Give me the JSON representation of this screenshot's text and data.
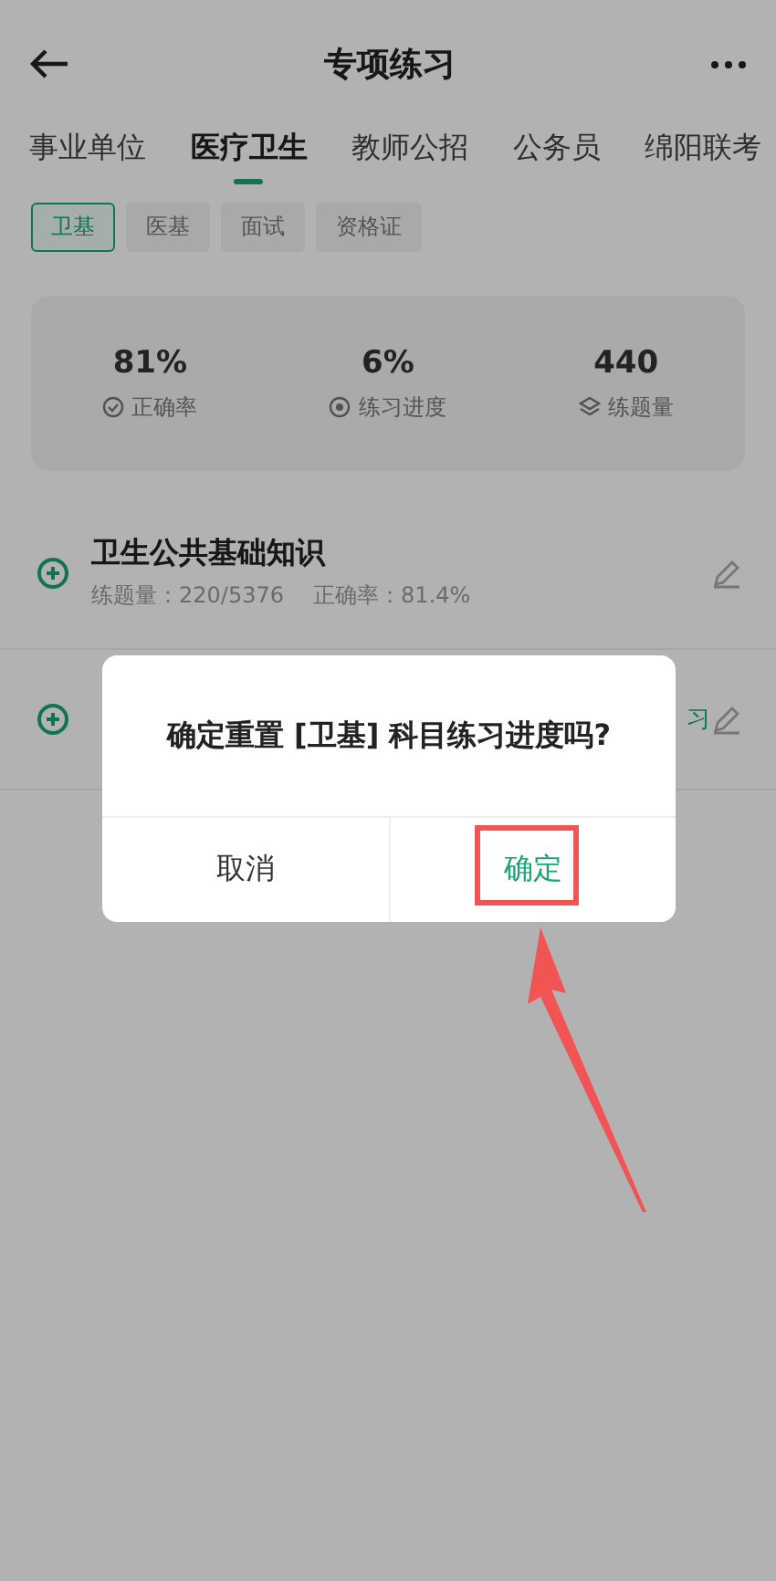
{
  "header": {
    "title": "专项练习"
  },
  "tabs": [
    {
      "label": "事业单位",
      "selected": false
    },
    {
      "label": "医疗卫生",
      "selected": true
    },
    {
      "label": "教师公招",
      "selected": false
    },
    {
      "label": "公务员",
      "selected": false
    },
    {
      "label": "绵阳联考",
      "selected": false
    }
  ],
  "chips": [
    {
      "label": "卫基",
      "selected": true
    },
    {
      "label": "医基",
      "selected": false
    },
    {
      "label": "面试",
      "selected": false
    },
    {
      "label": "资格证",
      "selected": false
    }
  ],
  "stats": [
    {
      "kind": "accuracy",
      "value": "81%",
      "label": "正确率"
    },
    {
      "kind": "progress",
      "value": "6%",
      "label": "练习进度"
    },
    {
      "kind": "count",
      "value": "440",
      "label": "练题量"
    }
  ],
  "subjects": [
    {
      "title": "卫生公共基础知识",
      "count": "练题量：220/5376",
      "accuracy": "正确率：81.4%"
    },
    {
      "action": "习"
    }
  ],
  "dialog": {
    "message": "确定重置 [卫基] 科目练习进度吗?",
    "buttons": [
      {
        "label": "取消",
        "kind": "cancel"
      },
      {
        "label": "确定",
        "kind": "confirm"
      }
    ]
  }
}
